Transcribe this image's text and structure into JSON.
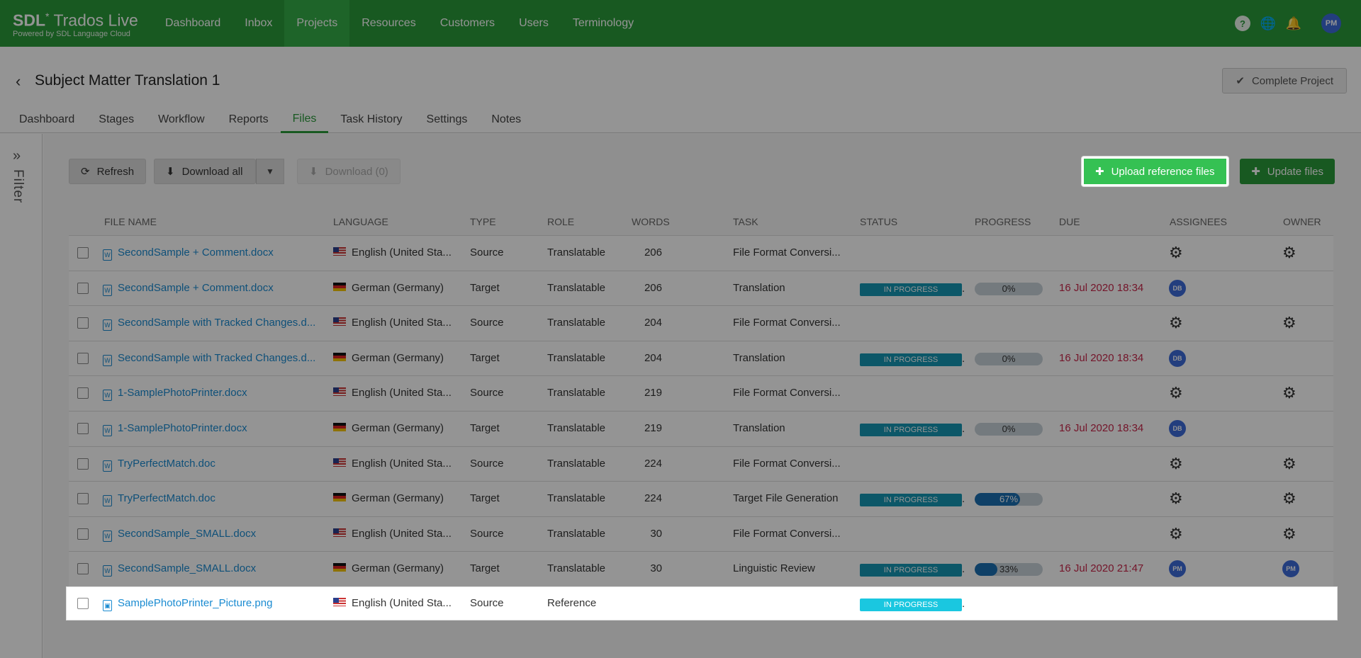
{
  "brand": {
    "logo_bold": "SDL",
    "logo_rest": "Trados Live",
    "tagline": "Powered by SDL Language Cloud"
  },
  "nav": {
    "items": [
      "Dashboard",
      "Inbox",
      "Projects",
      "Resources",
      "Customers",
      "Users",
      "Terminology"
    ],
    "active": "Projects",
    "help_icon": "?",
    "user_initials": "PM"
  },
  "header": {
    "title": "Subject Matter Translation 1",
    "complete_label": "Complete Project",
    "tabs": [
      "Dashboard",
      "Stages",
      "Workflow",
      "Reports",
      "Files",
      "Task History",
      "Settings",
      "Notes"
    ],
    "active_tab": "Files"
  },
  "filter": {
    "label": "Filter"
  },
  "toolbar": {
    "refresh": "Refresh",
    "download_all": "Download all",
    "download": "Download (0)",
    "upload_reference": "Upload reference files",
    "update_files": "Update files"
  },
  "table": {
    "columns": [
      "FILE NAME",
      "LANGUAGE",
      "TYPE",
      "ROLE",
      "WORDS",
      "TASK",
      "STATUS",
      "PROGRESS",
      "DUE",
      "ASSIGNEES",
      "OWNER"
    ],
    "rows": [
      {
        "file": "SecondSample + Comment.docx",
        "icon": "word-doc-icon",
        "flag": "us",
        "language": "English (United Sta...",
        "type": "Source",
        "role": "Translatable",
        "words": "206",
        "task": "File Format Conversi...",
        "status": "",
        "progress": null,
        "due": "",
        "assignee": "gear",
        "owner": "gear"
      },
      {
        "file": "SecondSample + Comment.docx",
        "icon": "word-doc-icon",
        "flag": "de",
        "language": "German (Germany)",
        "type": "Target",
        "role": "Translatable",
        "words": "206",
        "task": "Translation",
        "status": "IN PROGRESS",
        "progress": 0,
        "progress_label": "0%",
        "due": "16 Jul 2020 18:34",
        "assignee": "DB",
        "owner": ""
      },
      {
        "file": "SecondSample with Tracked Changes.d...",
        "icon": "word-doc-icon",
        "flag": "us",
        "language": "English (United Sta...",
        "type": "Source",
        "role": "Translatable",
        "words": "204",
        "task": "File Format Conversi...",
        "status": "",
        "progress": null,
        "due": "",
        "assignee": "gear",
        "owner": "gear"
      },
      {
        "file": "SecondSample with Tracked Changes.d...",
        "icon": "word-doc-icon",
        "flag": "de",
        "language": "German (Germany)",
        "type": "Target",
        "role": "Translatable",
        "words": "204",
        "task": "Translation",
        "status": "IN PROGRESS",
        "progress": 0,
        "progress_label": "0%",
        "due": "16 Jul 2020 18:34",
        "assignee": "DB",
        "owner": ""
      },
      {
        "file": "1-SamplePhotoPrinter.docx",
        "icon": "word-doc-icon",
        "flag": "us",
        "language": "English (United Sta...",
        "type": "Source",
        "role": "Translatable",
        "words": "219",
        "task": "File Format Conversi...",
        "status": "",
        "progress": null,
        "due": "",
        "assignee": "gear",
        "owner": "gear"
      },
      {
        "file": "1-SamplePhotoPrinter.docx",
        "icon": "word-doc-icon",
        "flag": "de",
        "language": "German (Germany)",
        "type": "Target",
        "role": "Translatable",
        "words": "219",
        "task": "Translation",
        "status": "IN PROGRESS",
        "progress": 0,
        "progress_label": "0%",
        "due": "16 Jul 2020 18:34",
        "assignee": "DB",
        "owner": ""
      },
      {
        "file": "TryPerfectMatch.doc",
        "icon": "word-doc-icon",
        "flag": "us",
        "language": "English (United Sta...",
        "type": "Source",
        "role": "Translatable",
        "words": "224",
        "task": "File Format Conversi...",
        "status": "",
        "progress": null,
        "due": "",
        "assignee": "gear",
        "owner": "gear"
      },
      {
        "file": "TryPerfectMatch.doc",
        "icon": "word-doc-icon",
        "flag": "de",
        "language": "German (Germany)",
        "type": "Target",
        "role": "Translatable",
        "words": "224",
        "task": "Target File Generation",
        "status": "IN PROGRESS",
        "progress": 67,
        "progress_label": "67%",
        "due": "",
        "assignee": "gear",
        "owner": "gear"
      },
      {
        "file": "SecondSample_SMALL.docx",
        "icon": "word-doc-icon",
        "flag": "us",
        "language": "English (United Sta...",
        "type": "Source",
        "role": "Translatable",
        "words": "30",
        "task": "File Format Conversi...",
        "status": "",
        "progress": null,
        "due": "",
        "assignee": "gear",
        "owner": "gear"
      },
      {
        "file": "SecondSample_SMALL.docx",
        "icon": "word-doc-icon",
        "flag": "de",
        "language": "German (Germany)",
        "type": "Target",
        "role": "Translatable",
        "words": "30",
        "task": "Linguistic Review",
        "status": "IN PROGRESS",
        "progress": 33,
        "progress_label": "33%",
        "due": "16 Jul 2020 21:47",
        "assignee": "PM",
        "owner": "PM"
      },
      {
        "file": "SamplePhotoPrinter_Picture.png",
        "icon": "image-file-icon",
        "flag": "us",
        "language": "English (United Sta...",
        "type": "Source",
        "role": "Reference",
        "words": "",
        "task": "",
        "status": "IN PROGRESS",
        "progress": null,
        "due": "",
        "assignee": "",
        "owner": ""
      }
    ]
  },
  "colors": {
    "brand_green": "#2a9a3a",
    "link_blue": "#1a8bd1",
    "status_teal": "#1597b3",
    "due_red": "#c8264a",
    "avatar_blue": "#3d6bd9"
  }
}
